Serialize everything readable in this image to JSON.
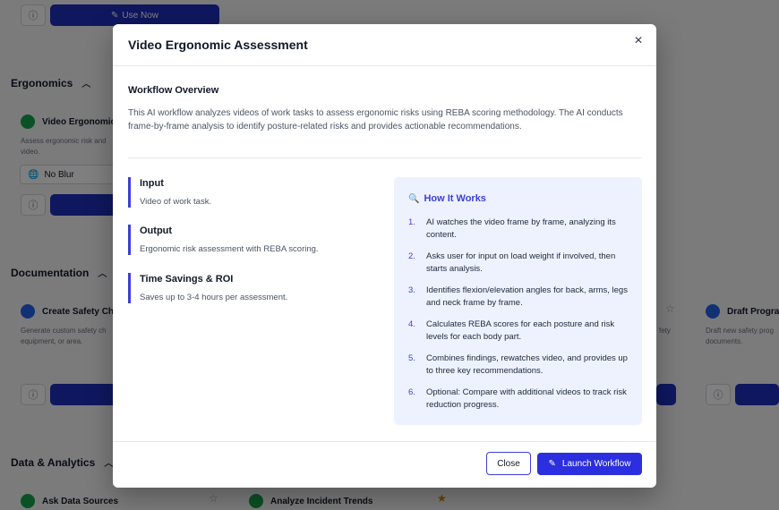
{
  "background": {
    "use_now_label": "Use Now",
    "sections": {
      "ergonomics": "Ergonomics",
      "documentation": "Documentation",
      "data_analytics": "Data & Analytics"
    },
    "cards": {
      "video_ergonomic": {
        "title": "Video Ergonomic",
        "desc_line1": "Assess ergonomic risk and",
        "desc_line2": "video."
      },
      "blur_option": "No Blur",
      "create_safety": {
        "title": "Create Safety Ch",
        "desc_line1": "Generate custom safety ch",
        "desc_line2": "equipment, or area."
      },
      "draft_program": {
        "title": "Draft Progra",
        "desc_line1": "Draft new safety prog",
        "desc_line2": "documents."
      },
      "partial_right_desc": "fety",
      "ask_data": {
        "title": "Ask Data Sources"
      },
      "analyze_incident": {
        "title": "Analyze Incident Trends"
      }
    },
    "icons": {
      "info": "info-icon",
      "star": "star-icon",
      "chevron": "chevron-up-icon",
      "globe": "globe-icon"
    }
  },
  "modal": {
    "title": "Video Ergonomic Assessment",
    "overview_title": "Workflow Overview",
    "overview_text": "This AI workflow analyzes videos of work tasks to assess ergonomic risks using REBA scoring methodology. The AI conducts frame-by-frame analysis to identify posture-related risks and provides actionable recommendations.",
    "input_label": "Input",
    "input_value": "Video of work task.",
    "output_label": "Output",
    "output_value": "Ergonomic risk assessment with REBA scoring.",
    "savings_label": "Time Savings & ROI",
    "savings_value": "Saves up to 3-4 hours per assessment.",
    "how_title": "How It Works",
    "steps": [
      {
        "num": "1.",
        "text": "AI watches the video frame by frame, analyzing its content."
      },
      {
        "num": "2.",
        "text": "Asks user for input on load weight if involved, then starts analysis."
      },
      {
        "num": "3.",
        "text": "Identifies flexion/elevation angles for back, arms, legs and neck frame by frame."
      },
      {
        "num": "4.",
        "text": "Calculates REBA scores for each posture and risk levels for each body part."
      },
      {
        "num": "5.",
        "text": "Combines findings, rewatches video, and provides up to three key recommendations."
      },
      {
        "num": "6.",
        "text": "Optional: Compare with additional videos to track risk reduction progress."
      }
    ],
    "close_label": "Close",
    "launch_label": "Launch Workflow",
    "accent_color": "#2c2fe0"
  }
}
